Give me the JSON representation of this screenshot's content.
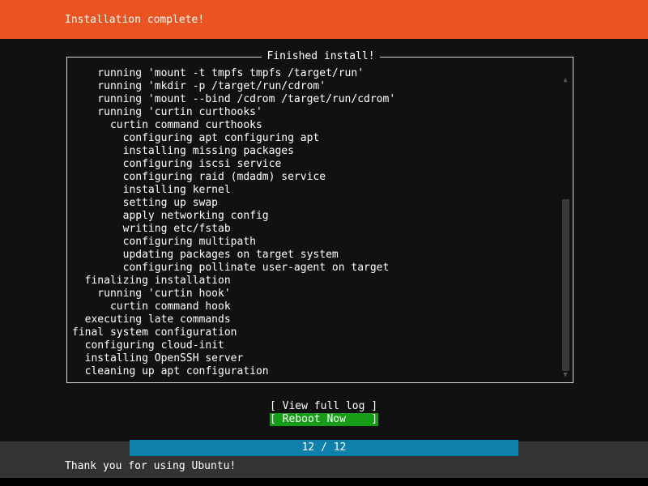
{
  "header": {
    "title": "Installation complete!",
    "background_color": "#e95420",
    "text_color": "#ffffff"
  },
  "log_panel": {
    "title": "Finished install!",
    "border_color": "#dcdcdc",
    "background_color": "#111111",
    "lines": [
      "    running 'mount -t tmpfs tmpfs /target/run'",
      "    running 'mkdir -p /target/run/cdrom'",
      "    running 'mount --bind /cdrom /target/run/cdrom'",
      "    running 'curtin curthooks'",
      "      curtin command curthooks",
      "        configuring apt configuring apt",
      "        installing missing packages",
      "        configuring iscsi service",
      "        configuring raid (mdadm) service",
      "        installing kernel",
      "        setting up swap",
      "        apply networking config",
      "        writing etc/fstab",
      "        configuring multipath",
      "        updating packages on target system",
      "        configuring pollinate user-agent on target",
      "  finalizing installation",
      "    running 'curtin hook'",
      "      curtin command hook",
      "  executing late commands",
      "final system configuration",
      "  configuring cloud-init",
      "  installing OpenSSH server",
      "  cleaning up apt configuration"
    ],
    "scrollbar": {
      "up_arrow": "▲",
      "down_arrow": "▼",
      "thumb_color": "#3a3a3a",
      "arrow_color": "#555555"
    }
  },
  "actions": {
    "view_full_log": "[ View full log ]",
    "reboot_now": "[ Reboot Now    ]",
    "selected": "reboot_now",
    "selected_background": "#169c16"
  },
  "progress": {
    "label": "12 / 12",
    "current": 12,
    "total": 12,
    "percent": 100,
    "fill_color": "#0e80ab",
    "track_color": "#333333"
  },
  "footer": {
    "message": "Thank you for using Ubuntu!",
    "background_color": "#333333",
    "text_color": "#ffffff"
  }
}
